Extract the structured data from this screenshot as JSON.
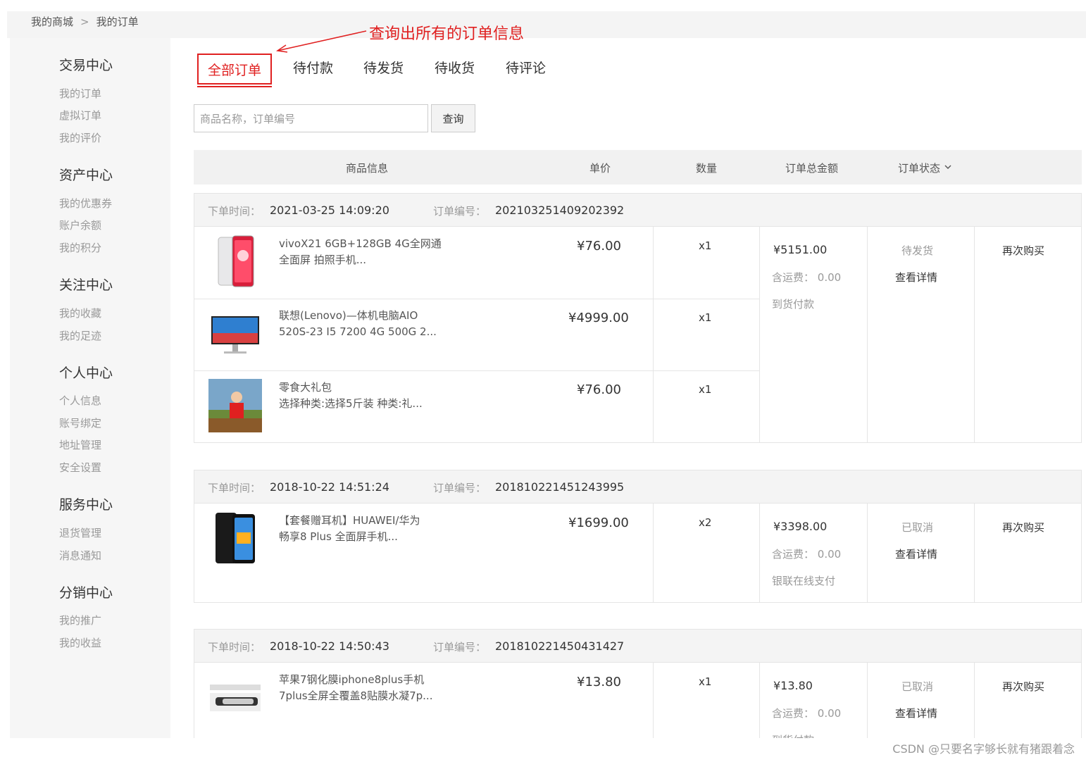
{
  "breadcrumb": {
    "home": "我的商城",
    "current": "我的订单"
  },
  "annotation": {
    "text": "查询出所有的订单信息",
    "color": "#e02020"
  },
  "sidebar": {
    "sections": [
      {
        "title": "交易中心",
        "items": [
          "我的订单",
          "虚拟订单",
          "我的评价"
        ]
      },
      {
        "title": "资产中心",
        "items": [
          "我的优惠券",
          "账户余额",
          "我的积分"
        ]
      },
      {
        "title": "关注中心",
        "items": [
          "我的收藏",
          "我的足迹"
        ]
      },
      {
        "title": "个人中心",
        "items": [
          "个人信息",
          "账号绑定",
          "地址管理",
          "安全设置"
        ]
      },
      {
        "title": "服务中心",
        "items": [
          "退货管理",
          "消息通知"
        ]
      },
      {
        "title": "分销中心",
        "items": [
          "我的推广",
          "我的收益"
        ]
      }
    ]
  },
  "tabs": [
    "全部订单",
    "待付款",
    "待发货",
    "待收货",
    "待评论"
  ],
  "search": {
    "placeholder": "商品名称，订单编号",
    "button": "查询"
  },
  "table_header": {
    "product": "商品信息",
    "price": "单价",
    "qty": "数量",
    "total": "订单总金额",
    "status": "订单状态"
  },
  "order_labels": {
    "time": "下单时间：",
    "number": "订单编号：",
    "shipping": "含运费："
  },
  "orders": [
    {
      "time": "2021-03-25 14:09:20",
      "number": "202103251409202392",
      "items": [
        {
          "name1": "vivoX21 6GB+128GB 4G全网通",
          "name2": "全面屏 拍照手机...",
          "price": "¥76.00",
          "qty": "x1"
        },
        {
          "name1": "联想(Lenovo)—体机电脑AIO",
          "name2": "520S-23 I5 7200 4G 500G 2...",
          "price": "¥4999.00",
          "qty": "x1"
        },
        {
          "name1": "零食大礼包",
          "name2": "选择种类:选择5斤装 种类:礼...",
          "price": "¥76.00",
          "qty": "x1"
        }
      ],
      "total": "¥5151.00",
      "shipping": "0.00",
      "payment": "到货付款",
      "status": "待发货",
      "detail": "查看详情",
      "rebuy": "再次购买"
    },
    {
      "time": "2018-10-22 14:51:24",
      "number": "201810221451243995",
      "items": [
        {
          "name1": "【套餐赠耳机】HUAWEI/华为",
          "name2": "畅享8 Plus 全面屏手机...",
          "price": "¥1699.00",
          "qty": "x2"
        }
      ],
      "total": "¥3398.00",
      "shipping": "0.00",
      "payment": "银联在线支付",
      "status": "已取消",
      "detail": "查看详情",
      "rebuy": "再次购买"
    },
    {
      "time": "2018-10-22 14:50:43",
      "number": "201810221450431427",
      "items": [
        {
          "name1": "苹果7钢化膜iphone8plus手机",
          "name2": "7plus全屏全覆盖8贴膜水凝7p...",
          "price": "¥13.80",
          "qty": "x1"
        }
      ],
      "total": "¥13.80",
      "shipping": "0.00",
      "payment": "到货付款",
      "status": "已取消",
      "detail": "查看详情",
      "rebuy": "再次购买"
    }
  ],
  "watermark": "CSDN @只要名字够长就有猪跟着念"
}
